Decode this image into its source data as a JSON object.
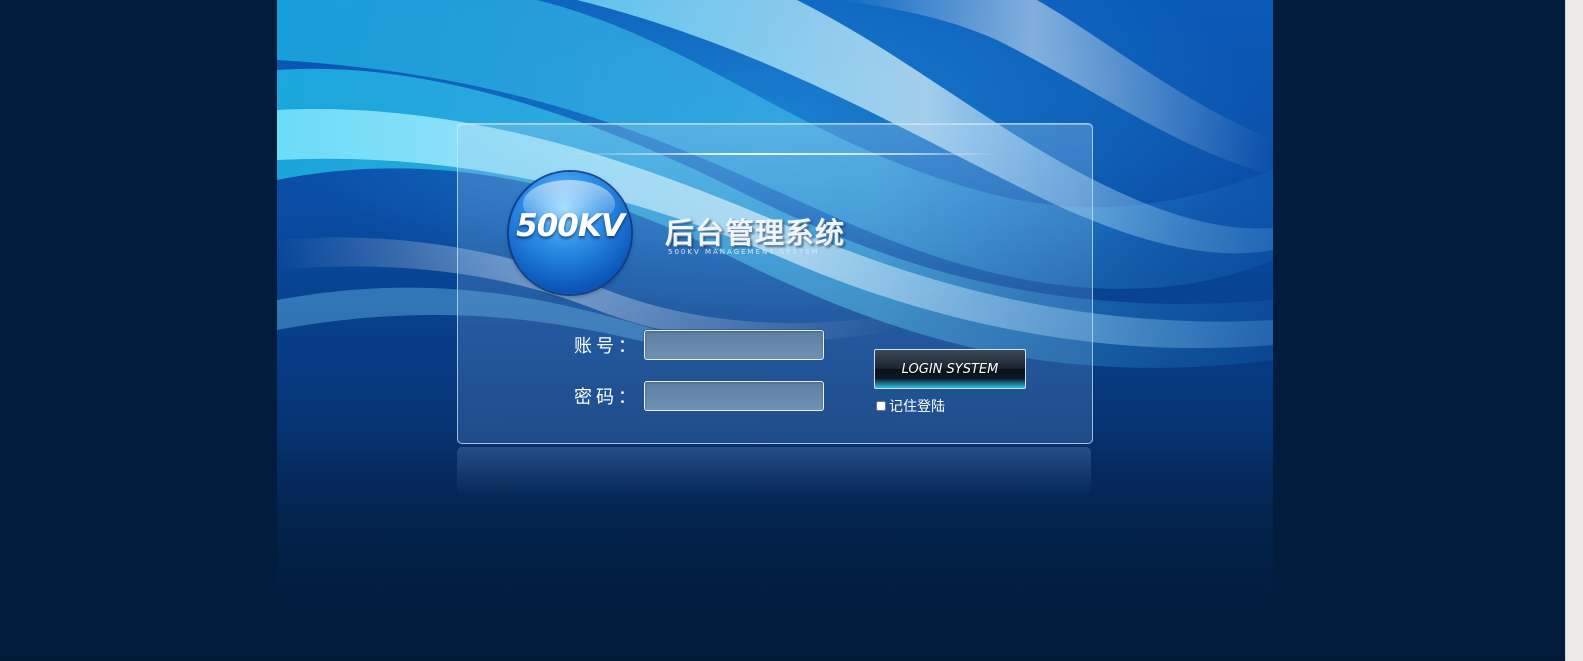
{
  "brand": {
    "logo_text": "500KV",
    "title": "后台管理系统",
    "subtitle": "500KV MANAGEMENT SYSTEM"
  },
  "login_form": {
    "username_label": "账号：",
    "username_value": "",
    "password_label": "密码：",
    "password_value": "",
    "submit_label": "LOGIN SYSTEM",
    "remember_label": "记住登陆",
    "remember_checked": false
  },
  "colors": {
    "page_background": "#011c3d",
    "hero_blue": "#0a5ab8",
    "accent_cyan": "#2ec0e8"
  }
}
